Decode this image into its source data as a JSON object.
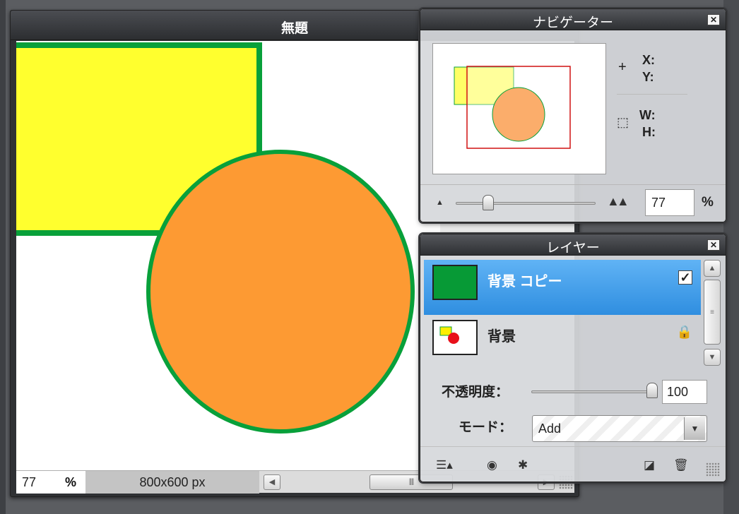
{
  "document": {
    "title": "無題",
    "zoom_value": "77",
    "zoom_unit": "%",
    "size_label": "800x600 px"
  },
  "navigator": {
    "title": "ナビゲーター",
    "close": "✕",
    "x_label": "X:",
    "y_label": "Y:",
    "w_label": "W:",
    "h_label": "H:",
    "zoom_value": "77",
    "zoom_unit": "%",
    "zoom_fraction": 0.23
  },
  "layers": {
    "title": "レイヤー",
    "close": "✕",
    "items": [
      {
        "name": "背景 コピー",
        "selected": true,
        "visible_checked": true
      },
      {
        "name": "背景",
        "selected": false,
        "locked": true
      }
    ],
    "opacity_label": "不透明度：",
    "opacity_value": "100",
    "mode_label": "モード：",
    "mode_value": "Add"
  },
  "icons": {
    "close": "close-icon",
    "crosshair": "crosshair-icon",
    "selection": "selection-size-icon",
    "lock": "lock-icon",
    "check": "checkbox-icon",
    "adjust": "layer-adjust-icon",
    "mask": "layer-mask-icon",
    "effects": "layer-effects-icon",
    "new_layer": "new-layer-icon",
    "trash": "trash-icon"
  },
  "colors": {
    "canvas_rect_fill": "#ffff2e",
    "canvas_ellipse_fill": "#fd9a33",
    "shape_stroke": "#08a03a",
    "selected_layer": "#3a98e6",
    "nav_viewport": "#d01010"
  }
}
